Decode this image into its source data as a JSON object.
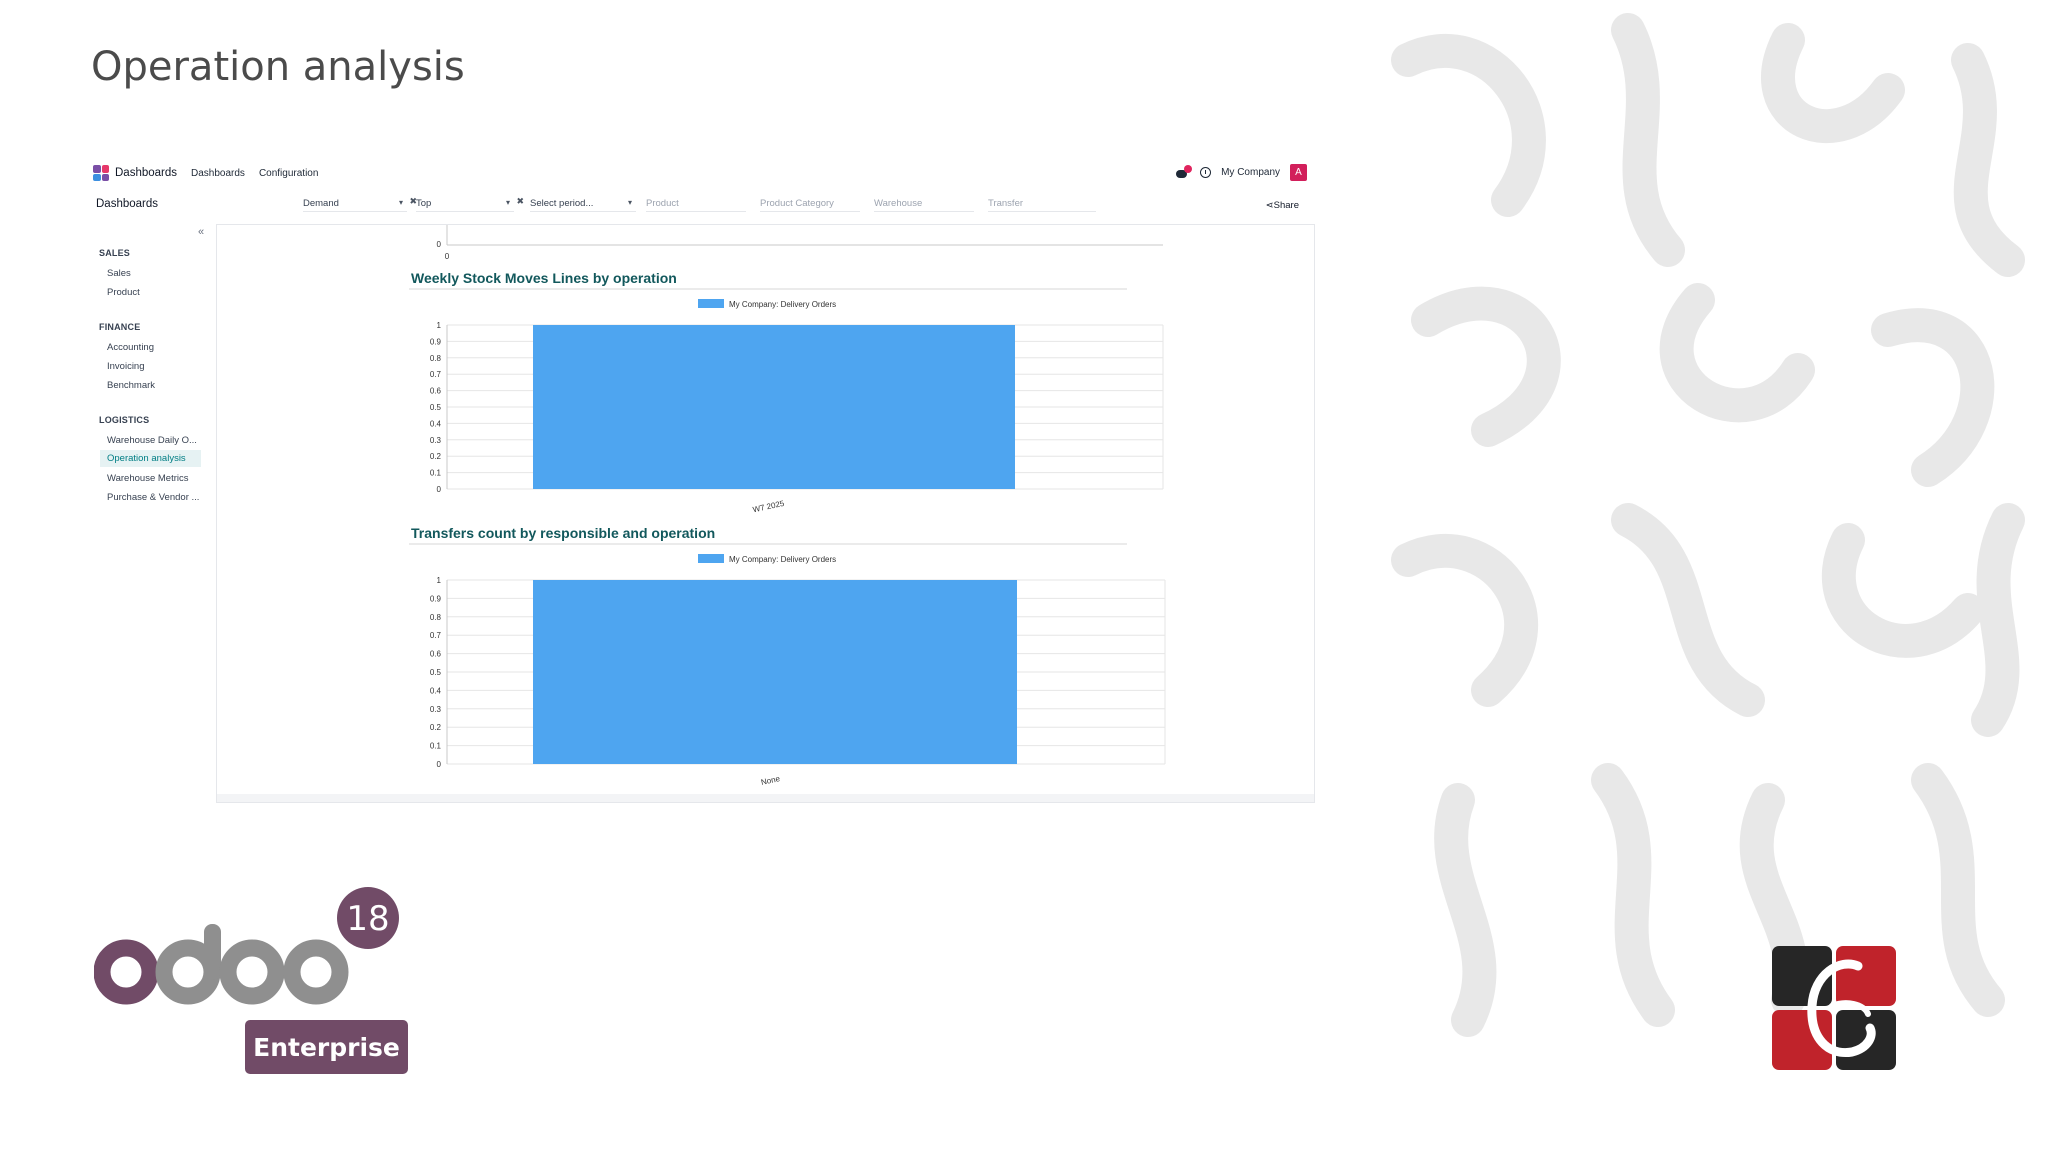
{
  "slide": {
    "title": "Operation analysis"
  },
  "navbar": {
    "app_name": "Dashboards",
    "menu": [
      "Dashboards",
      "Configuration"
    ],
    "company": "My Company",
    "avatar_initial": "A",
    "chat_badge": "1"
  },
  "controlbar": {
    "breadcrumb": "Dashboards",
    "filters": [
      {
        "value": "Demand",
        "placeholder": false,
        "clearable": true
      },
      {
        "value": "Top",
        "placeholder": false,
        "clearable": true
      },
      {
        "value": "Select period...",
        "placeholder": false,
        "clearable": false
      },
      {
        "value": "Product",
        "placeholder": true,
        "clearable": false
      },
      {
        "value": "Product Category",
        "placeholder": true,
        "clearable": false
      },
      {
        "value": "Warehouse",
        "placeholder": true,
        "clearable": false
      },
      {
        "value": "Transfer",
        "placeholder": true,
        "clearable": false
      }
    ],
    "share_label": "Share"
  },
  "sidebar": {
    "collapse_label": "«",
    "sections": [
      {
        "title": "SALES",
        "items": [
          "Sales",
          "Product"
        ]
      },
      {
        "title": "FINANCE",
        "items": [
          "Accounting",
          "Invoicing",
          "Benchmark"
        ]
      },
      {
        "title": "LOGISTICS",
        "items": [
          "Warehouse Daily O...",
          "Operation analysis",
          "Warehouse Metrics",
          "Purchase & Vendor ..."
        ]
      }
    ],
    "active_item": "Operation analysis"
  },
  "chart_data": [
    {
      "type": "bar",
      "title": "",
      "partial": true,
      "categories": [
        "0"
      ],
      "y_tick_labels": [
        "0"
      ],
      "series": []
    },
    {
      "type": "bar",
      "title": "Weekly Stock Moves Lines by operation",
      "categories": [
        "W7 2025"
      ],
      "series": [
        {
          "name": "My Company: Delivery Orders",
          "values": [
            1
          ]
        }
      ],
      "ylim": [
        0,
        1
      ],
      "yticks": [
        "0",
        "0.1",
        "0.2",
        "0.3",
        "0.4",
        "0.5",
        "0.6",
        "0.7",
        "0.8",
        "0.9",
        "1"
      ],
      "color": "#4ea5f0",
      "legend": "top"
    },
    {
      "type": "bar",
      "title": "Transfers count by responsible and operation",
      "categories": [
        "None"
      ],
      "series": [
        {
          "name": "My Company: Delivery Orders",
          "values": [
            1
          ]
        }
      ],
      "ylim": [
        0,
        1
      ],
      "yticks": [
        "0",
        "0.1",
        "0.2",
        "0.3",
        "0.4",
        "0.5",
        "0.6",
        "0.7",
        "0.8",
        "0.9",
        "1"
      ],
      "color": "#4ea5f0",
      "legend": "top"
    }
  ],
  "branding": {
    "version_badge": "18",
    "edition": "Enterprise",
    "odoo_colors": {
      "purple": "#714b67",
      "gray": "#8f8f8f"
    }
  }
}
